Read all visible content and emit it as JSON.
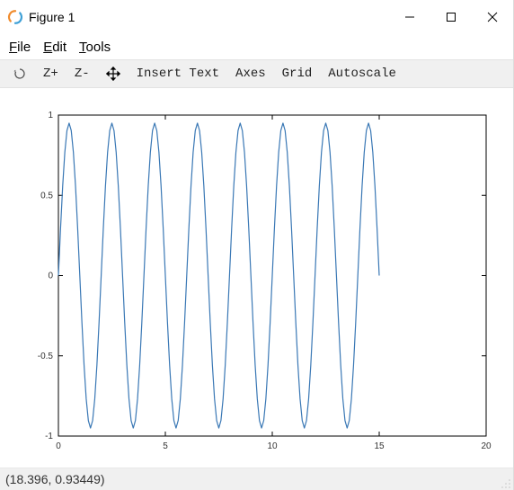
{
  "window": {
    "title": "Figure 1"
  },
  "menu": {
    "file": "File",
    "edit": "Edit",
    "tools": "Tools"
  },
  "toolbar": {
    "rotate": "⟳",
    "zoom_in": "Z+",
    "zoom_out": "Z-",
    "pan": "✥",
    "insert_text": "Insert Text",
    "axes": "Axes",
    "grid": "Grid",
    "autoscale": "Autoscale"
  },
  "status": {
    "coords": "(18.396, 0.93449)"
  },
  "chart_data": {
    "type": "line",
    "title": "",
    "xlabel": "",
    "ylabel": "",
    "xlim": [
      0,
      20
    ],
    "ylim": [
      -1,
      1
    ],
    "xticks": [
      0,
      5,
      10,
      15,
      20
    ],
    "yticks": [
      -1,
      -0.5,
      0,
      0.5,
      1
    ],
    "ytick_labels": [
      "-1",
      "-0.5",
      "0",
      "0.5",
      "1"
    ],
    "series": [
      {
        "name": "sin",
        "color": "#3a78b5",
        "x_step": 0.1,
        "x_start": 0.0,
        "x_end": 15.0,
        "function": "sin",
        "omega": 3.1416,
        "amplitude": 0.95,
        "extrema_x": [
          0.5,
          1.5,
          2.5,
          3.5,
          4.5,
          5.5,
          6.5,
          7.5,
          8.5,
          9.5,
          10.5,
          11.5,
          12.5,
          13.5,
          14.5
        ],
        "extrema_y": [
          0.95,
          -0.95,
          0.95,
          -0.95,
          0.95,
          -0.95,
          0.95,
          -0.95,
          0.95,
          -0.95,
          0.95,
          -0.95,
          0.95,
          -0.95,
          0.95
        ]
      }
    ]
  },
  "colors": {
    "line": "#3a78b5",
    "axes": "#000000",
    "toolbar_bg": "#f0f0f0",
    "icon_orange": "#f08c2e",
    "icon_blue": "#3fa0d6"
  }
}
